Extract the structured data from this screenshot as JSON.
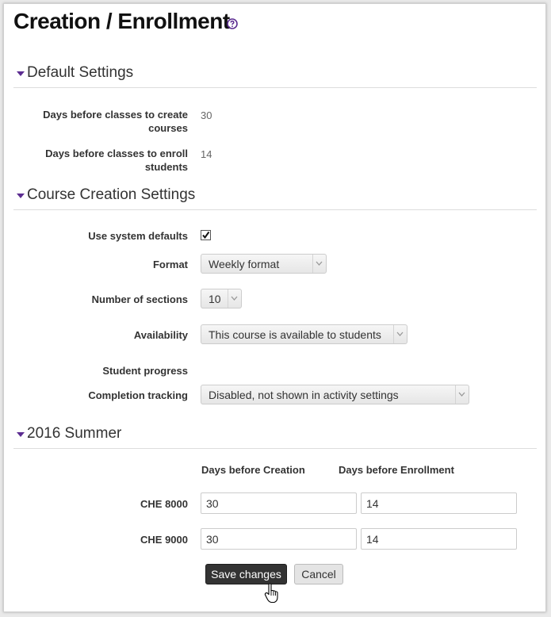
{
  "page": {
    "title": "Creation / Enrollment"
  },
  "sections": {
    "default": {
      "title": "Default Settings"
    },
    "course_creation": {
      "title": "Course Creation Settings"
    },
    "term": {
      "title": "2016 Summer"
    }
  },
  "default_settings": {
    "create_label": "Days before classes to create courses",
    "create_value": "30",
    "enroll_label": "Days before classes to enroll students",
    "enroll_value": "14"
  },
  "course_creation": {
    "use_defaults_label": "Use system defaults",
    "use_defaults_checked": true,
    "format_label": "Format",
    "format_value": "Weekly format",
    "sections_label": "Number of sections",
    "sections_value": "10",
    "availability_label": "Availability",
    "availability_value": "This course is available to students",
    "progress_label": "Student progress",
    "completion_label": "Completion tracking",
    "completion_value": "Disabled, not shown in activity settings"
  },
  "term": {
    "col_creation": "Days before Creation",
    "col_enrollment": "Days before Enrollment",
    "rows": [
      {
        "course": "CHE 8000",
        "creation": "30",
        "enrollment": "14"
      },
      {
        "course": "CHE 9000",
        "creation": "30",
        "enrollment": "14"
      }
    ]
  },
  "buttons": {
    "save": "Save changes",
    "cancel": "Cancel"
  },
  "colors": {
    "accent": "#5c2d91",
    "primary_button": "#333333"
  }
}
